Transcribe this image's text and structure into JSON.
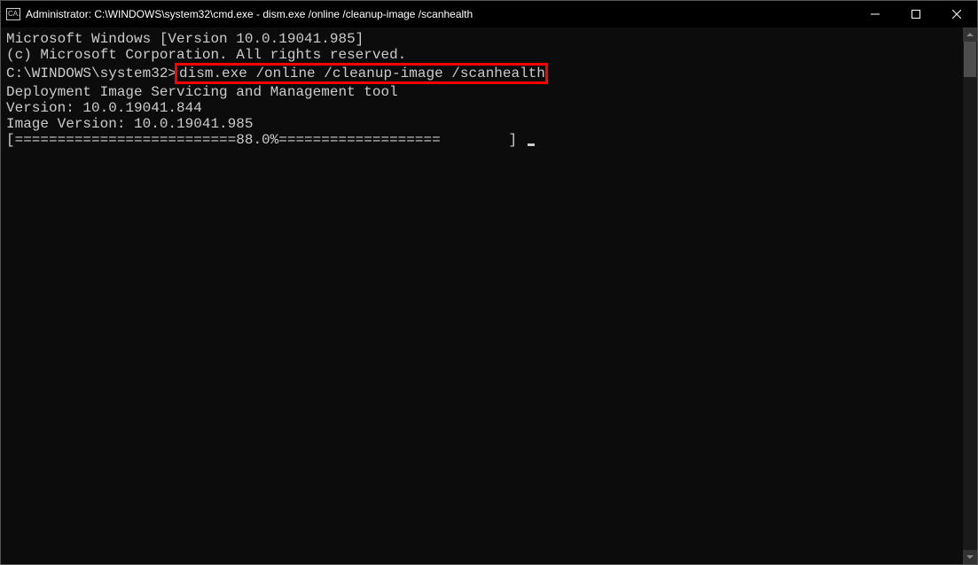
{
  "titlebar": {
    "icon_text": "CA.",
    "title": "Administrator: C:\\WINDOWS\\system32\\cmd.exe - dism.exe  /online /cleanup-image /scanhealth"
  },
  "terminal": {
    "line1": "Microsoft Windows [Version 10.0.19041.985]",
    "line2": "(c) Microsoft Corporation. All rights reserved.",
    "blank1": "",
    "prompt": "C:\\WINDOWS\\system32>",
    "command": "dism.exe /online /cleanup-image /scanhealth",
    "blank2": "",
    "line3": "Deployment Image Servicing and Management tool",
    "line4": "Version: 10.0.19041.844",
    "blank3": "",
    "line5": "Image Version: 10.0.19041.985",
    "blank4": "",
    "progress_open": "[==========================88.0%===================        ] "
  }
}
